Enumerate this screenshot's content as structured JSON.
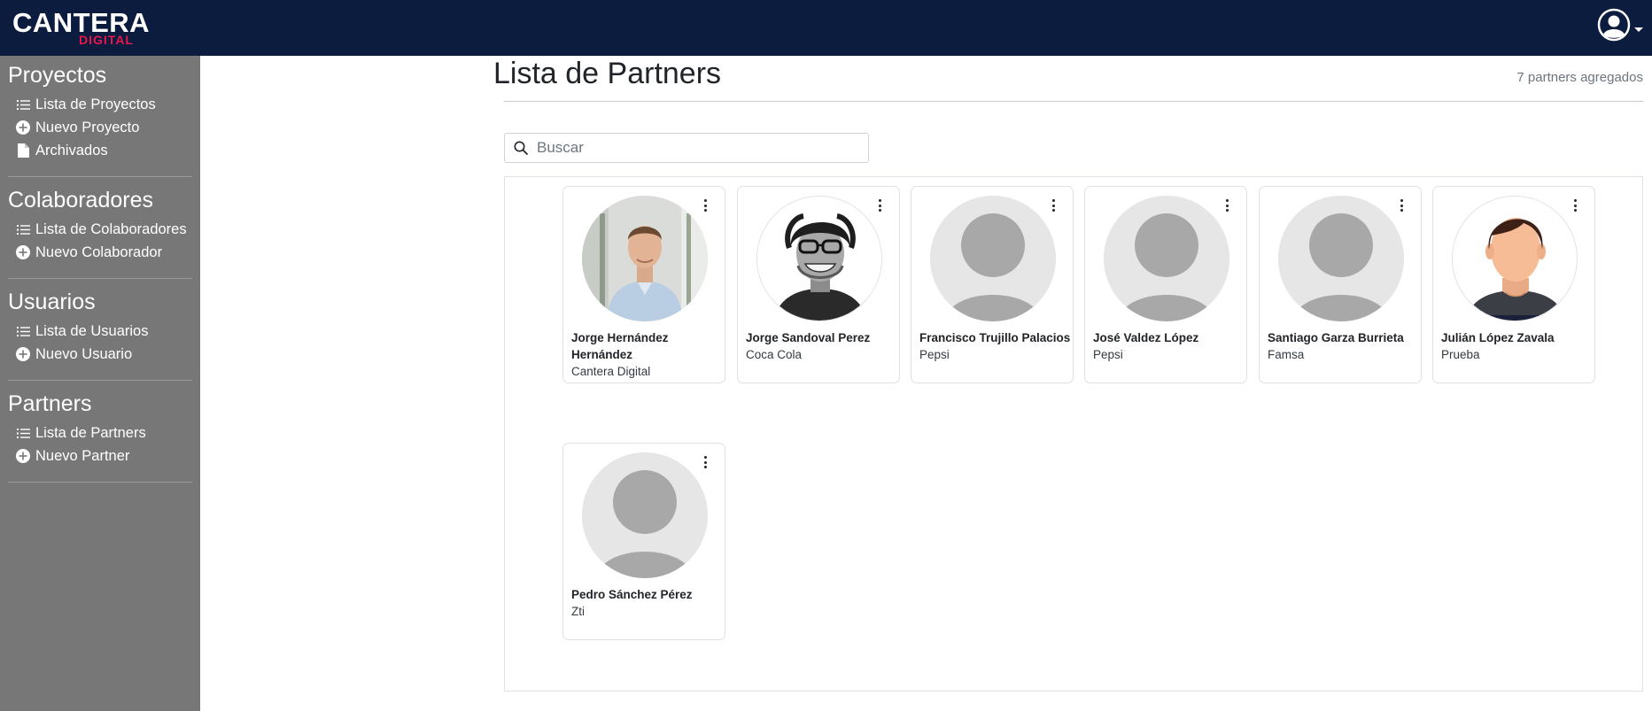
{
  "brand": {
    "main": "CANTERA",
    "sub": "DIGITAL"
  },
  "header": {
    "user_icon": "user-circle-icon"
  },
  "sidebar": {
    "sections": [
      {
        "title": "Proyectos",
        "items": [
          {
            "label": "Lista de Proyectos",
            "icon": "list-icon"
          },
          {
            "label": "Nuevo Proyecto",
            "icon": "plus-circle-icon"
          },
          {
            "label": "Archivados",
            "icon": "file-icon"
          }
        ]
      },
      {
        "title": "Colaboradores",
        "items": [
          {
            "label": "Lista de Colaboradores",
            "icon": "list-icon"
          },
          {
            "label": "Nuevo Colaborador",
            "icon": "plus-circle-icon"
          }
        ]
      },
      {
        "title": "Usuarios",
        "items": [
          {
            "label": "Lista de Usuarios",
            "icon": "list-icon"
          },
          {
            "label": "Nuevo Usuario",
            "icon": "plus-circle-icon"
          }
        ]
      },
      {
        "title": "Partners",
        "items": [
          {
            "label": "Lista de Partners",
            "icon": "list-icon"
          },
          {
            "label": "Nuevo Partner",
            "icon": "plus-circle-icon"
          }
        ]
      }
    ]
  },
  "main": {
    "title": "Lista de Partners",
    "count": "7 partners agregados",
    "search": {
      "placeholder": "Buscar",
      "value": ""
    },
    "partners": [
      {
        "name": "Jorge Hernández Hernández",
        "company": "Cantera Digital",
        "avatar": "photo-man-blue-shirt"
      },
      {
        "name": "Jorge Sandoval Perez",
        "company": "Coca Cola",
        "avatar": "photo-man-glasses-bw"
      },
      {
        "name": "Francisco Trujillo Palacios",
        "company": "Pepsi",
        "avatar": "default-avatar"
      },
      {
        "name": "José Valdez López",
        "company": "Pepsi",
        "avatar": "default-avatar"
      },
      {
        "name": "Santiago Garza Burrieta",
        "company": "Famsa",
        "avatar": "default-avatar"
      },
      {
        "name": "Julián López Zavala",
        "company": "Prueba",
        "avatar": "illustrated-man-avatar"
      },
      {
        "name": "Pedro Sánchez Pérez",
        "company": "Zti",
        "avatar": "default-avatar"
      }
    ]
  },
  "colors": {
    "topbar": "#0c1c3e",
    "sidebar": "#777777",
    "brand_accent": "#e8174d"
  }
}
